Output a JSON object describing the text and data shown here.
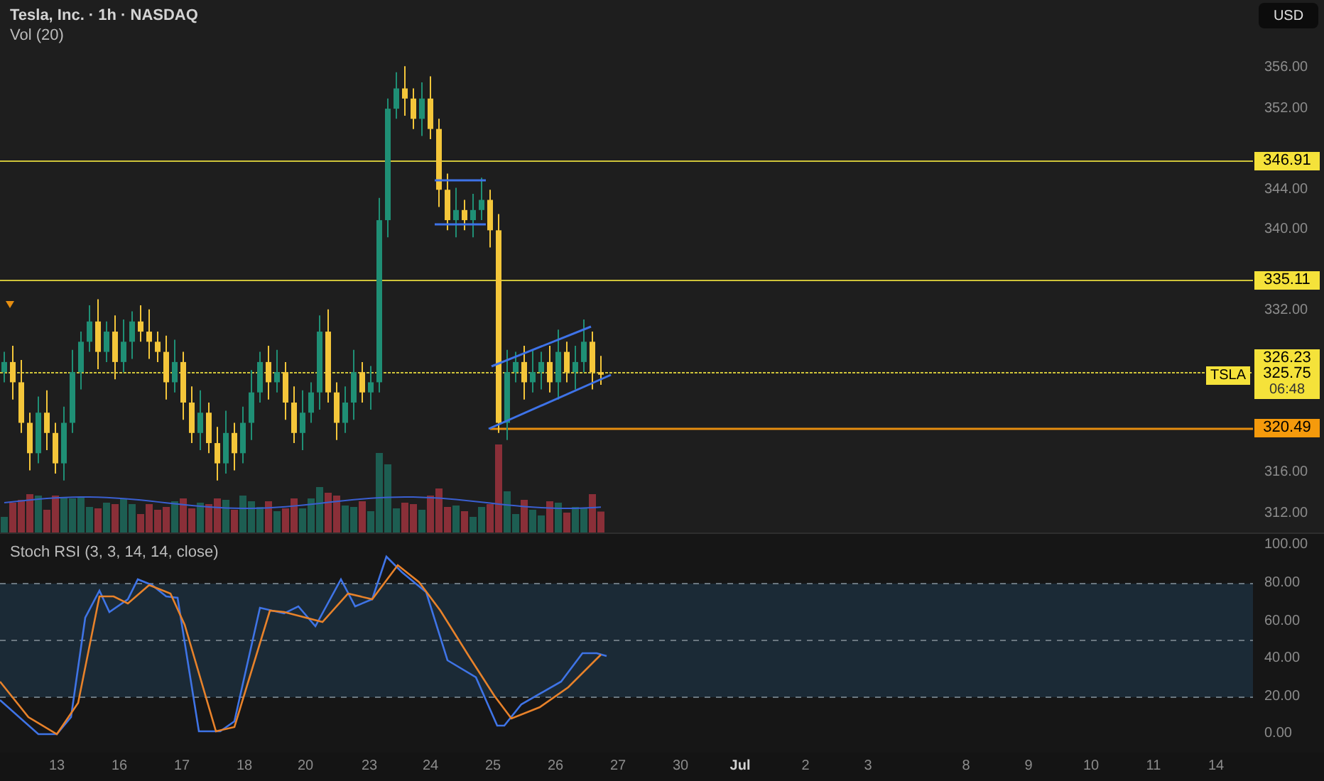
{
  "header": {
    "title": "Tesla, Inc. · 1h · NASDAQ",
    "indicator": "Vol (20)"
  },
  "currency_button": "USD",
  "price_axis": [
    "356.00",
    "352.00",
    "344.00",
    "340.00",
    "332.00",
    "316.00",
    "312.00"
  ],
  "level_tags": [
    {
      "text": "346.91",
      "color": "#f5e23a"
    },
    {
      "text": "335.11",
      "color": "#f5e23a"
    },
    {
      "text": "320.49",
      "color": "#f59a0c"
    }
  ],
  "last_price": {
    "symbol": "TSLA",
    "prices": [
      "326.23",
      "325.75"
    ],
    "countdown": "06:48"
  },
  "stoch_panel": {
    "title": "Stoch RSI (3, 3, 14, 14, close)",
    "axis": [
      "100.00",
      "80.00",
      "60.00",
      "40.00",
      "20.00",
      "0.00"
    ]
  },
  "time_axis": [
    {
      "label": "13",
      "kind": "day"
    },
    {
      "label": "16",
      "kind": "day"
    },
    {
      "label": "17",
      "kind": "day"
    },
    {
      "label": "18",
      "kind": "day"
    },
    {
      "label": "20",
      "kind": "day"
    },
    {
      "label": "23",
      "kind": "day"
    },
    {
      "label": "24",
      "kind": "day"
    },
    {
      "label": "25",
      "kind": "day"
    },
    {
      "label": "26",
      "kind": "day"
    },
    {
      "label": "27",
      "kind": "day"
    },
    {
      "label": "30",
      "kind": "day"
    },
    {
      "label": "Jul",
      "kind": "month"
    },
    {
      "label": "2",
      "kind": "day"
    },
    {
      "label": "3",
      "kind": "day"
    },
    {
      "label": "8",
      "kind": "day"
    },
    {
      "label": "9",
      "kind": "day"
    },
    {
      "label": "10",
      "kind": "day"
    },
    {
      "label": "11",
      "kind": "day"
    },
    {
      "label": "14",
      "kind": "day"
    }
  ]
}
